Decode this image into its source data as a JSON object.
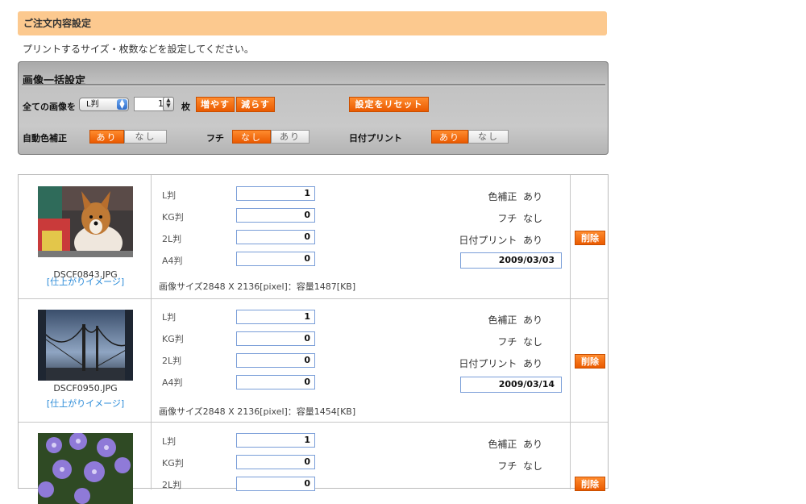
{
  "header": {
    "title": "ご注文内容設定",
    "intro": "プリントするサイズ・枚数などを設定してください。"
  },
  "bulk": {
    "title": "画像一括設定",
    "all_images_label": "全ての画像を",
    "size_select_value": "L判",
    "count_value": "1",
    "count_unit": "枚",
    "increase_label": "増やす",
    "decrease_label": "減らす",
    "reset_label": "設定をリセット",
    "auto_color": {
      "label": "自動色補正",
      "on": "あり",
      "off": "なし"
    },
    "border": {
      "label": "フチ",
      "on": "なし",
      "off": "あり"
    },
    "date_print": {
      "label": "日付プリント",
      "on": "あり",
      "off": "なし"
    }
  },
  "sizes": [
    "L判",
    "KG判",
    "2L判",
    "A4判"
  ],
  "labels": {
    "color_correction": "色補正",
    "border": "フチ",
    "date_print": "日付プリント",
    "finish_image": "[仕上がりイメージ]",
    "delete": "削除"
  },
  "items": [
    {
      "filename": "DSCF0843.JPG",
      "quantities": [
        "1",
        "0",
        "0",
        "0"
      ],
      "color_correction": "あり",
      "border": "なし",
      "date_print": "あり",
      "date": "2009/03/03",
      "info": "画像サイズ2848 X 2136[pixel]：容量1487[KB]"
    },
    {
      "filename": "DSCF0950.JPG",
      "quantities": [
        "1",
        "0",
        "0",
        "0"
      ],
      "color_correction": "あり",
      "border": "なし",
      "date_print": "あり",
      "date": "2009/03/14",
      "info": "画像サイズ2848 X 2136[pixel]：容量1454[KB]"
    },
    {
      "quantities": [
        "1",
        "0",
        "0"
      ],
      "color_correction": "あり",
      "border": "なし"
    }
  ],
  "colors": {
    "title_bar": "#fcc98f",
    "accent_orange": "#f06a10",
    "link_blue": "#2a8bd8",
    "input_border": "#7a9ed8"
  }
}
